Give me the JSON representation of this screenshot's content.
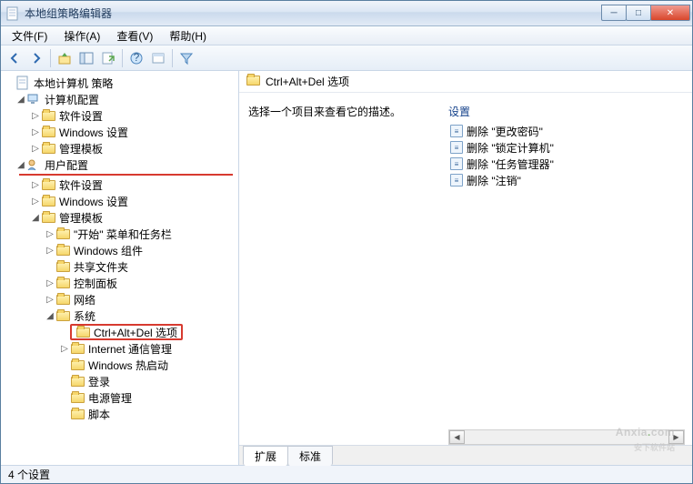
{
  "window": {
    "title": "本地组策略编辑器"
  },
  "menu": {
    "file": "文件(F)",
    "action": "操作(A)",
    "view": "查看(V)",
    "help": "帮助(H)"
  },
  "tree": {
    "root": "本地计算机 策略",
    "computer": "计算机配置",
    "c_software": "软件设置",
    "c_windows": "Windows 设置",
    "c_templates": "管理模板",
    "user": "用户配置",
    "u_software": "软件设置",
    "u_windows": "Windows 设置",
    "u_templates": "管理模板",
    "start": "\"开始\" 菜单和任务栏",
    "components": "Windows 组件",
    "shared": "共享文件夹",
    "control": "控制面板",
    "network": "网络",
    "system": "系统",
    "ctrl": "Ctrl+Alt+Del 选项",
    "internet": "Internet 通信管理",
    "hotstart": "Windows 热启动",
    "login": "登录",
    "power": "电源管理",
    "script": "脚本"
  },
  "right": {
    "header": "Ctrl+Alt+Del 选项",
    "prompt": "选择一个项目来查看它的描述。",
    "col": "设置",
    "items": [
      "删除 \"更改密码\"",
      "删除 \"锁定计算机\"",
      "删除 \"任务管理器\"",
      "删除 \"注销\""
    ],
    "tab_extended": "扩展",
    "tab_standard": "标准"
  },
  "status": "4 个设置",
  "watermark": {
    "main_a": "Anxia",
    "main_b": "com",
    "sub": "安下软件站"
  }
}
